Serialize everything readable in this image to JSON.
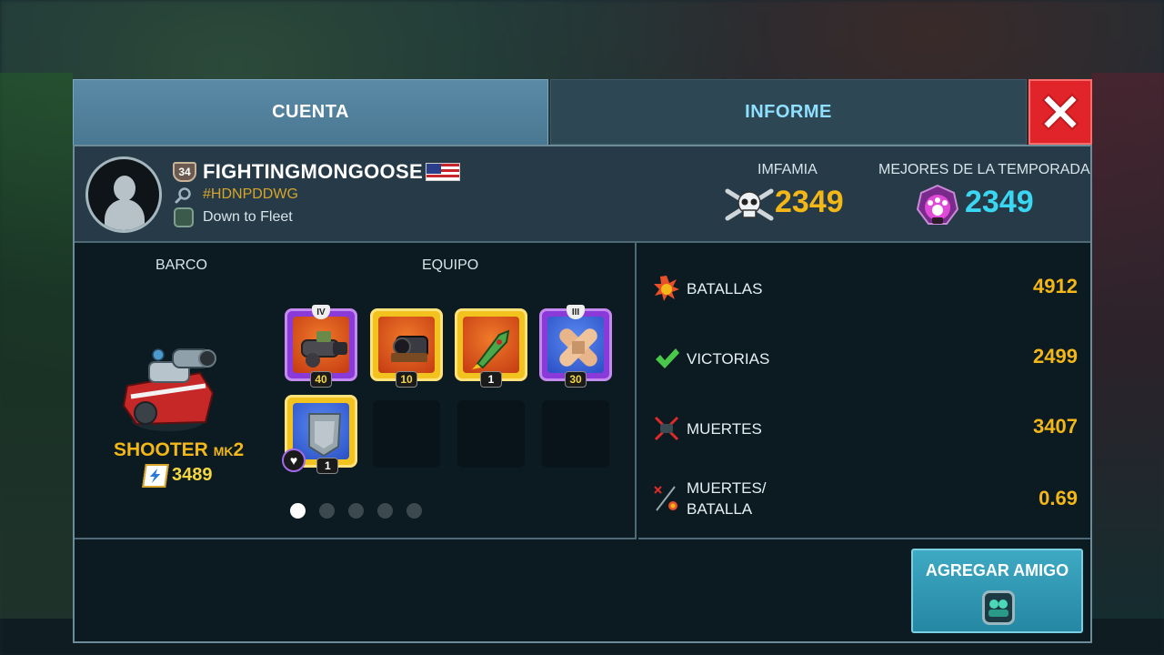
{
  "tabs": {
    "cuenta": "CUENTA",
    "informe": "INFORME"
  },
  "player": {
    "level": "34",
    "name": "FIGHTINGMONGOOSE",
    "tag": "#HDNPDDWG",
    "fleet": "Down to Fleet"
  },
  "header_stats": {
    "imfamia_label": "IMFAMIA",
    "imfamia_value": "2349",
    "season_label": "MEJORES DE LA TEMPORADA",
    "season_value": "2349"
  },
  "loadout": {
    "barco_label": "BARCO",
    "equipo_label": "EQUIPO",
    "ship_name": "SHOOTER",
    "ship_mk_prefix": "MK",
    "ship_mk": "2",
    "ship_power": "3489",
    "cards": [
      {
        "tier": "IV",
        "count": "40"
      },
      {
        "count": "10"
      },
      {
        "count": "1"
      },
      {
        "tier": "III",
        "count": "30"
      },
      {
        "count": "1"
      }
    ],
    "pages": 5,
    "active_page": 1
  },
  "stats": [
    {
      "label": "BATALLAS",
      "value": "4912"
    },
    {
      "label": "VICTORIAS",
      "value": "2499"
    },
    {
      "label": "MUERTES",
      "value": "3407"
    },
    {
      "label_line1": "MUERTES/",
      "label_line2": "BATALLA",
      "value": "0.69"
    }
  ],
  "add_friend": {
    "label": "AGREGAR AMIGO"
  },
  "icons": {
    "close": "close-icon",
    "level": "level-shield-icon",
    "search": "search-icon",
    "fleet": "fleet-icon",
    "infamy": "skull-crossbones-icon",
    "season": "paw-badge-icon",
    "power": "lightning-icon",
    "battles": "explosion-icon",
    "victories": "checkmark-icon",
    "kills": "crossed-swords-icon",
    "kd": "ratio-icon",
    "heart": "heart-icon",
    "add_friend": "fleet-icon"
  },
  "colors": {
    "gold": "#f3b718",
    "cyan": "#3ad6f2",
    "close_red": "#e0242a",
    "add_friend_bg": "#2f9bb5",
    "tab_active": "#5a8aa6",
    "tab_inactive_text": "#8fe0ff"
  }
}
